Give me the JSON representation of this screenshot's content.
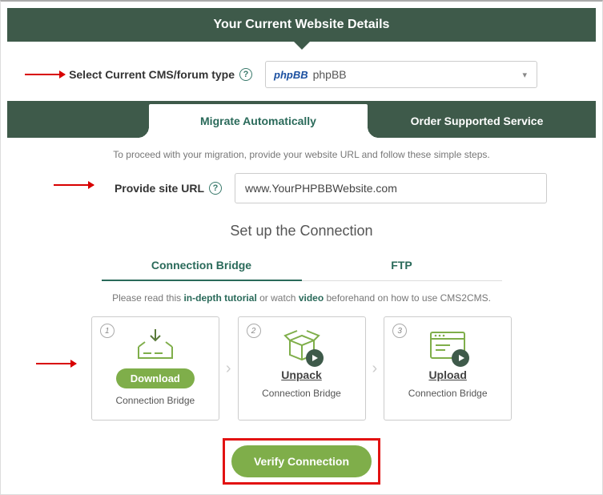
{
  "header": {
    "title": "Your Current Website Details"
  },
  "cms": {
    "label": "Select Current CMS/forum type",
    "selected": "phpBB",
    "logo_text": "phpBB"
  },
  "tabs": {
    "migrate": "Migrate Automatically",
    "order": "Order Supported Service"
  },
  "instruction": "To proceed with your migration, provide your website URL and follow these simple steps.",
  "url": {
    "label": "Provide site URL",
    "value": "www.YourPHPBBWebsite.com"
  },
  "connection": {
    "heading": "Set up the Connection",
    "tab_bridge": "Connection Bridge",
    "tab_ftp": "FTP",
    "note_pre": "Please read this ",
    "note_link1": "in-depth tutorial",
    "note_mid": " or watch ",
    "note_link2": "video",
    "note_post": " beforehand on how to use CMS2CMS."
  },
  "steps": {
    "s1": {
      "num": "1",
      "action": "Download",
      "sub": "Connection Bridge"
    },
    "s2": {
      "num": "2",
      "action": "Unpack",
      "sub": "Connection Bridge"
    },
    "s3": {
      "num": "3",
      "action": "Upload",
      "sub": "Connection Bridge"
    }
  },
  "verify": {
    "label": "Verify Connection"
  }
}
